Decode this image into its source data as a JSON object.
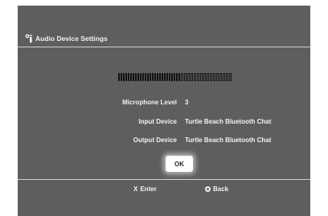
{
  "header": {
    "title": "Audio Device Settings",
    "icon": "audio-settings-icon"
  },
  "meter": {
    "level_fraction": 0.6,
    "total_segments": 42,
    "active_segments": 26
  },
  "settings": [
    {
      "label": "Microphone Level",
      "value": "3"
    },
    {
      "label": "Input Device",
      "value": "Turtle Beach Bluetooth Chat"
    },
    {
      "label": "Output Device",
      "value": "Turtle Beach Bluetooth Chat"
    }
  ],
  "ok_button": {
    "label": "OK"
  },
  "footer": {
    "enter": {
      "key": "X",
      "label": "Enter"
    },
    "back": {
      "icon": "circle-button-icon",
      "label": "Back"
    }
  },
  "colors": {
    "background": "#5e5e5e",
    "text": "#f2f2f2",
    "divider": "#d0d0d0",
    "meter_active": "#101010"
  }
}
